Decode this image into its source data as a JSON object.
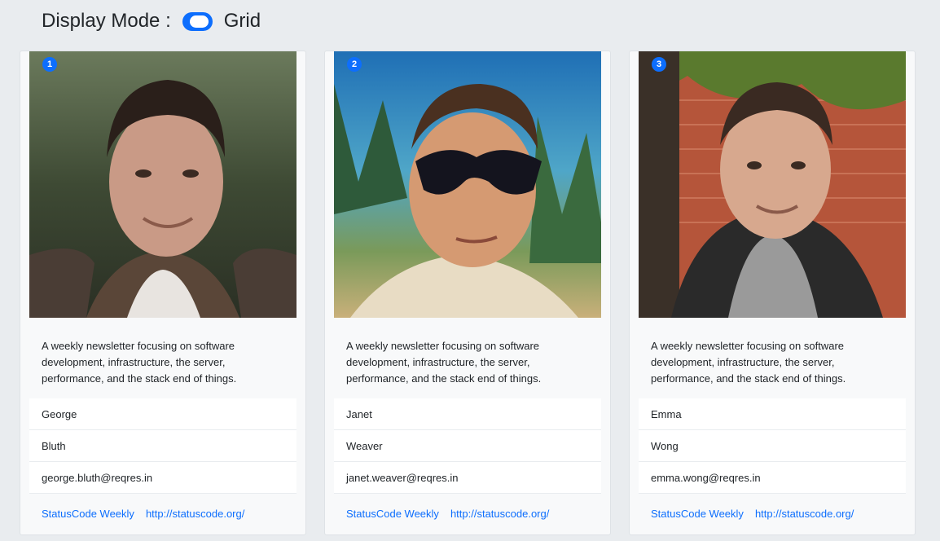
{
  "header": {
    "label": "Display Mode :",
    "mode": "Grid",
    "toggle_on": true
  },
  "colors": {
    "accent": "#0d6efd",
    "background": "#e9ecef",
    "card": "#f8f9fa"
  },
  "users": [
    {
      "id": "1",
      "description": "A weekly newsletter focusing on software development, infrastructure, the server, performance, and the stack end of things.",
      "first_name": "George",
      "last_name": "Bluth",
      "email": "george.bluth@reqres.in",
      "link_text": "StatusCode Weekly",
      "link_url": "http://statuscode.org/"
    },
    {
      "id": "2",
      "description": "A weekly newsletter focusing on software development, infrastructure, the server, performance, and the stack end of things.",
      "first_name": "Janet",
      "last_name": "Weaver",
      "email": "janet.weaver@reqres.in",
      "link_text": "StatusCode Weekly",
      "link_url": "http://statuscode.org/"
    },
    {
      "id": "3",
      "description": "A weekly newsletter focusing on software development, infrastructure, the server, performance, and the stack end of things.",
      "first_name": "Emma",
      "last_name": "Wong",
      "email": "emma.wong@reqres.in",
      "link_text": "StatusCode Weekly",
      "link_url": "http://statuscode.org/"
    }
  ]
}
